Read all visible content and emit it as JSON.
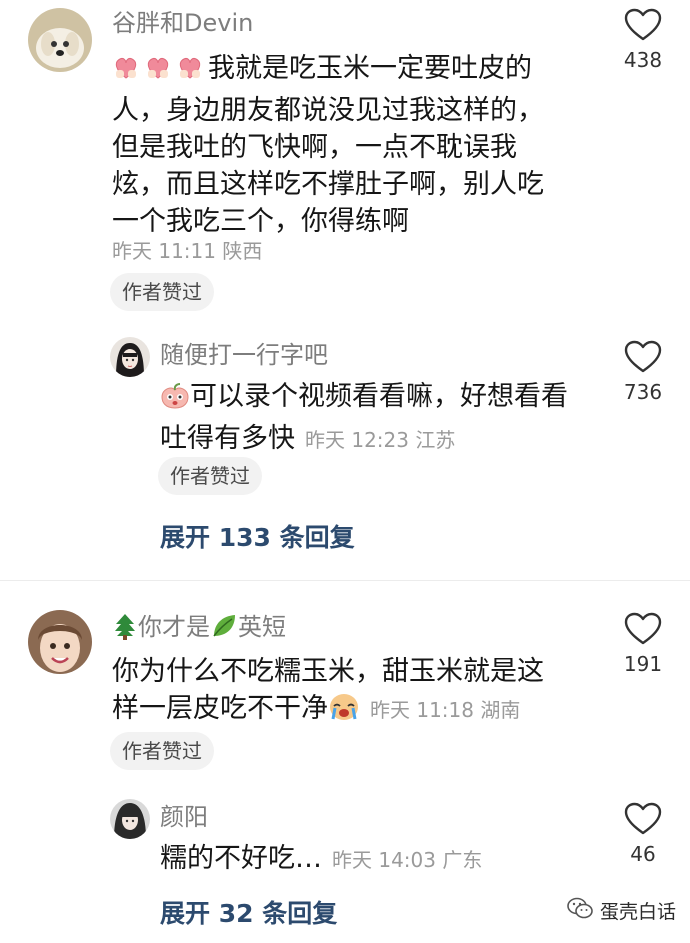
{
  "comments": [
    {
      "username": "谷胖和Devin",
      "lines": [
        "我就是吃玉米一定要吐皮的",
        "人，身边朋友都说没见过我这样的，",
        "但是我吐的飞快啊，一点不耽误我",
        "炫，而且这样吃不撑肚子啊，别人吃",
        "一个我吃三个，你得练啊"
      ],
      "meta": "昨天 11:11 陕西",
      "author_liked": "作者赞过",
      "likes": "438",
      "reply": {
        "username": "随便打一行字吧",
        "lines": [
          "可以录个视频看看嘛，好想看看",
          "吐得有多快"
        ],
        "meta": "昨天 12:23 江苏",
        "author_liked": "作者赞过",
        "likes": "736"
      },
      "expand": "展开 133 条回复"
    },
    {
      "username_prefix": "你才是",
      "username_suffix": "英短",
      "lines": [
        "你为什么不吃糯玉米，甜玉米就是这",
        "样一层皮吃不干净"
      ],
      "meta": "昨天 11:18 湖南",
      "author_liked": "作者赞过",
      "likes": "191",
      "reply": {
        "username": "颜阳",
        "lines": [
          "糯的不好吃…"
        ],
        "meta": "昨天 14:03 广东",
        "likes": "46"
      },
      "expand": "展开 32 条回复"
    }
  ],
  "watermark": "蛋壳白话",
  "icons": {
    "like": "heart-outline-icon",
    "watermark": "wechat-icon"
  }
}
